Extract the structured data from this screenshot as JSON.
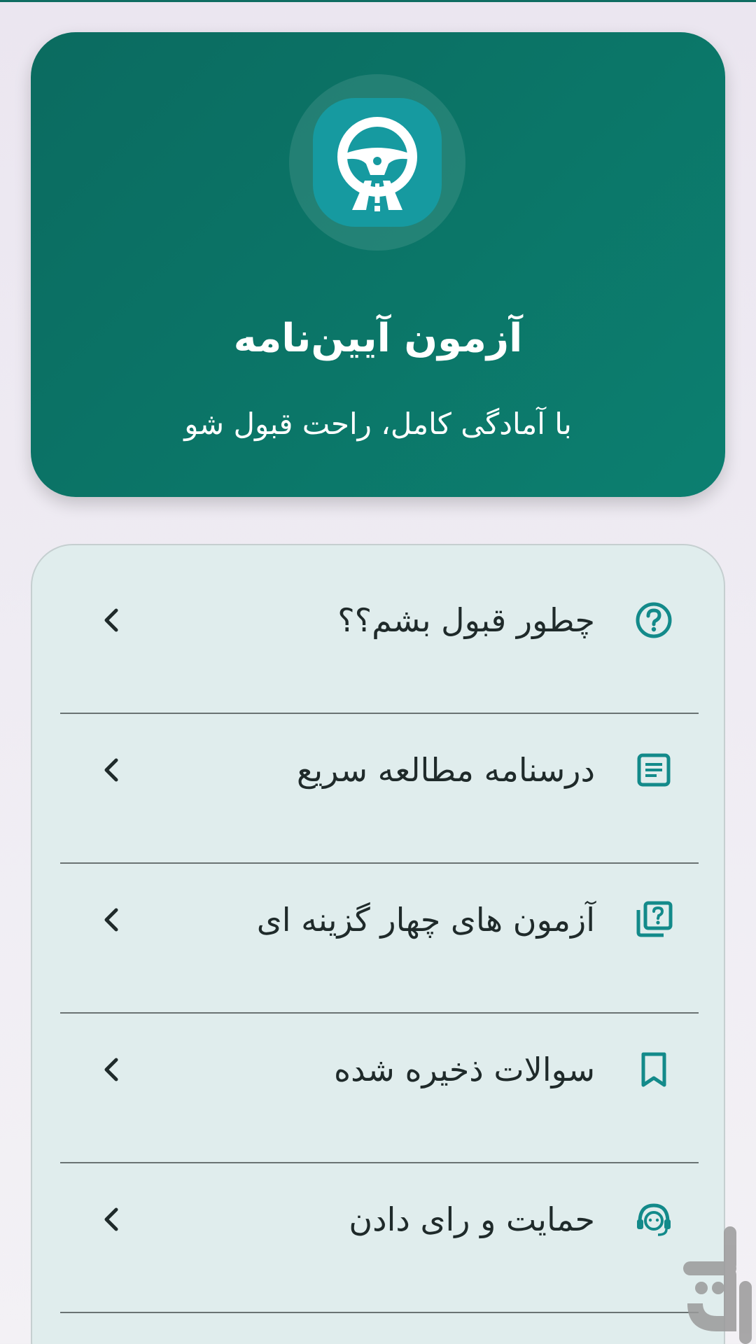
{
  "header": {
    "app_title": "آزمون آیین‌نامه",
    "subtitle": "با آمادگی کامل، راحت قبول شو",
    "logo_icon": "steering-wheel-road-icon"
  },
  "menu": {
    "items": [
      {
        "label": "چطور قبول بشم؟؟",
        "icon": "help-circle-icon"
      },
      {
        "label": "درسنامه مطالعه سریع",
        "icon": "article-icon"
      },
      {
        "label": "آزمون های چهار گزینه ای",
        "icon": "quiz-icon"
      },
      {
        "label": "سوالات ذخیره شده",
        "icon": "bookmark-icon"
      },
      {
        "label": "حمایت و رای دادن",
        "icon": "support-agent-icon"
      }
    ]
  },
  "colors": {
    "primary": "#0b7668",
    "accent_icon": "#138a8a",
    "menu_background": "#e0eded",
    "logo_tile": "#169aa0"
  }
}
